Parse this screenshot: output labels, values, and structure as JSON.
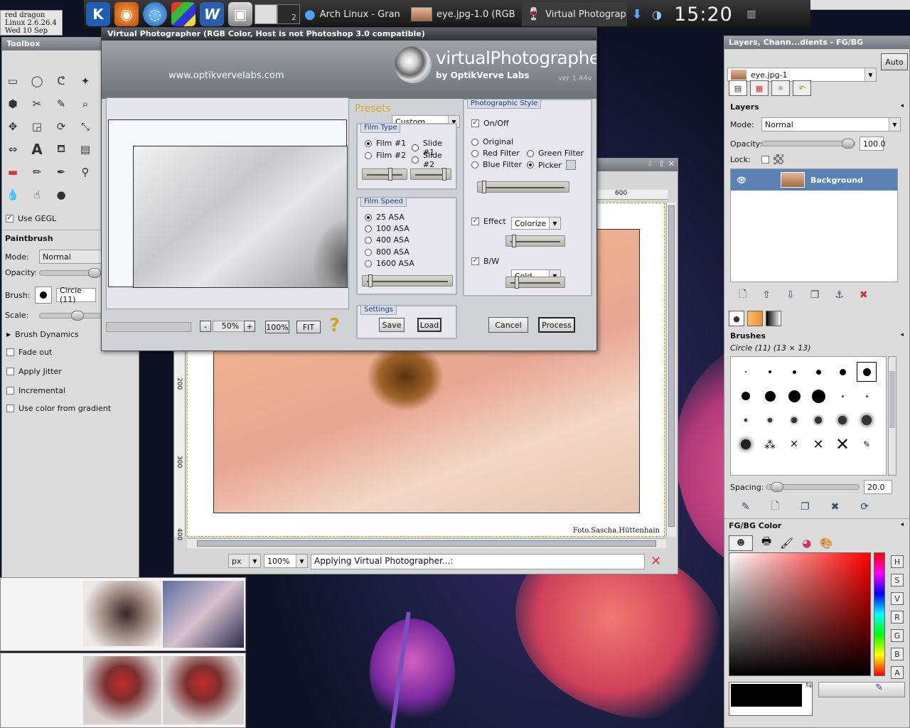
{
  "system_info": {
    "line1": "red dragon",
    "line2": "Linux 2.6.26.4",
    "line3": "Wed 10 Sep"
  },
  "taskbar": {
    "pager_label": "2",
    "items": [
      "Arch Linux - Gran",
      "eye.jpg-1.0 (RGB",
      "Virtual Photograp"
    ],
    "clock": "15:20"
  },
  "toolbox": {
    "title": "Toolbox",
    "use_gegl": "Use GEGL",
    "tool_name": "Paintbrush",
    "mode_label": "Mode:",
    "mode_value": "Normal",
    "opacity_label": "Opacity:",
    "brush_label": "Brush:",
    "brush_value": "Circle (11)",
    "scale_label": "Scale:",
    "dynamics": "Brush Dynamics",
    "options": [
      "Fade out",
      "Apply Jitter",
      "Incremental",
      "Use color from gradient"
    ]
  },
  "vp": {
    "title": "Virtual Photographer (RGB Color, Host is not Photoshop 3.0 compatible)",
    "url": "www.optikvervelabs.com",
    "logo": "virtualPhotographer",
    "logo_sub": "by OptikVerve Labs",
    "version": "ver 1.44v",
    "presets_label": "Presets",
    "presets_value": "Custom",
    "film_type": {
      "label": "Film Type",
      "options": [
        "Film #1",
        "Slide #1",
        "Film #2",
        "Slide #2"
      ],
      "selected": "Film #1"
    },
    "film_speed": {
      "label": "Film Speed",
      "options": [
        "25 ASA",
        "100 ASA",
        "400 ASA",
        "800 ASA",
        "1600 ASA"
      ],
      "selected": "25 ASA"
    },
    "style": {
      "label": "Photographic Style",
      "onoff": "On/Off",
      "options": [
        "Original",
        "Red Filter",
        "Green Filter",
        "Blue Filter",
        "Picker"
      ],
      "selected": "Picker",
      "effect_label": "Effect",
      "effect_value": "Colorize",
      "bw_label": "B/W",
      "bw_value": "Cold"
    },
    "settings": {
      "label": "Settings",
      "save": "Save",
      "load": "Load"
    },
    "zoom": {
      "minus": "-",
      "value": "50%",
      "plus": "+",
      "full": "100%",
      "fit": "FIT",
      "help": "?"
    },
    "cancel": "Cancel",
    "process": "Process"
  },
  "image_window": {
    "ruler_label": "600",
    "ruler_left": [
      "200",
      "300",
      "400"
    ],
    "credit": "Foto.Sascha.Hüttenhain",
    "unit": "px",
    "zoom": "100%",
    "status": "Applying Virtual Photographer...:"
  },
  "layers_panel": {
    "title": "Layers, Chann...dients - FG/BG",
    "image_value": "eye.jpg-1",
    "auto": "Auto",
    "section": "Layers",
    "mode_label": "Mode:",
    "mode_value": "Normal",
    "opacity_label": "Opacity:",
    "opacity_value": "100.0",
    "lock_label": "Lock:",
    "layer_name": "Background"
  },
  "brushes_panel": {
    "title": "Brushes",
    "subtitle": "Circle (11) (13 × 13)",
    "spacing_label": "Spacing:",
    "spacing_value": "20.0"
  },
  "color_panel": {
    "title": "FG/BG Color",
    "channels": [
      "H",
      "S",
      "V",
      "R",
      "G",
      "B",
      "A"
    ],
    "hex": "000000"
  },
  "colors": {
    "accent": "#5a82b4",
    "taskbar": "#1f1f1f",
    "vp_title": "#c8a020"
  }
}
